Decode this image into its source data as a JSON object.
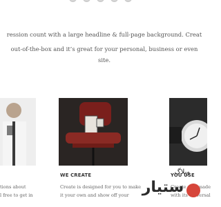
{
  "social_icons": [
    "facebook-icon",
    "twitter-icon",
    "pinterest-icon",
    "google-plus-icon",
    "rss-icon"
  ],
  "intro": {
    "line1": "ression count with a large headline & full-page background. Creat",
    "line2": "out-of-the-box and it’s great for your personal, business or even",
    "line3": "site."
  },
  "columns": [
    {
      "heading": "",
      "line1": "tions about",
      "line2": "l free to get in"
    },
    {
      "heading": "WE CREATE",
      "line1": "Create is designed for you to make",
      "line2": "it your own and show off your"
    },
    {
      "heading": "YOU USE",
      "line1": "Create was made",
      "line2": "with its universal"
    }
  ],
  "watermark": {
    "brand_text": "ستیار",
    "small_text": "وبلاگ"
  }
}
